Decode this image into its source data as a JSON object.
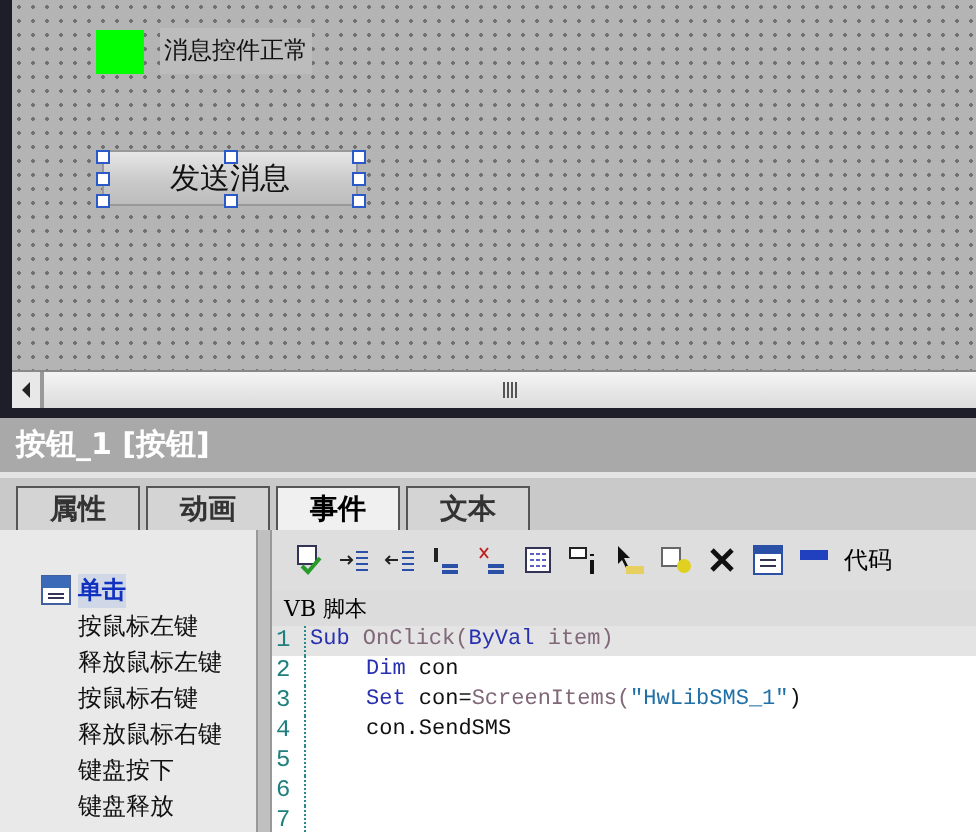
{
  "canvas": {
    "status": {
      "label": "消息控件正常",
      "color": "#00ff00"
    },
    "button": {
      "label": "发送消息",
      "selected": true
    }
  },
  "inspector": {
    "title": "按钮_1 [按钮]",
    "tabs": [
      {
        "label": "属性",
        "selected": false
      },
      {
        "label": "动画",
        "selected": false
      },
      {
        "label": "事件",
        "selected": true
      },
      {
        "label": "文本",
        "selected": false
      }
    ],
    "events": [
      {
        "label": "单击",
        "selected": true
      },
      {
        "label": "按鼠标左键",
        "selected": false
      },
      {
        "label": "释放鼠标左键",
        "selected": false
      },
      {
        "label": "按鼠标右键",
        "selected": false
      },
      {
        "label": "释放鼠标右键",
        "selected": false
      },
      {
        "label": "键盘按下",
        "selected": false
      },
      {
        "label": "键盘释放",
        "selected": false
      }
    ],
    "toolbar_text": "代码",
    "script_header": "VB 脚本",
    "code": [
      {
        "number": "1",
        "selected": true,
        "tokens": [
          {
            "kind": "keyword",
            "text": "Sub"
          },
          {
            "kind": "name",
            "text": " OnClick("
          },
          {
            "kind": "keyword",
            "text": "ByVal"
          },
          {
            "kind": "name",
            "text": " item)"
          }
        ]
      },
      {
        "number": "2",
        "selected": false,
        "indent": true,
        "tokens": [
          {
            "kind": "keyword",
            "text": "Dim"
          },
          {
            "kind": "text",
            "text": " con"
          }
        ]
      },
      {
        "number": "3",
        "selected": false,
        "indent": true,
        "tokens": [
          {
            "kind": "keyword",
            "text": "Set"
          },
          {
            "kind": "text",
            "text": " con="
          },
          {
            "kind": "name",
            "text": "ScreenItems("
          },
          {
            "kind": "string",
            "text": "\"HwLibSMS_1\""
          },
          {
            "kind": "text",
            "text": ")"
          }
        ]
      },
      {
        "number": "4",
        "selected": false,
        "indent": true,
        "tokens": [
          {
            "kind": "text",
            "text": "con.SendSMS"
          }
        ]
      },
      {
        "number": "5",
        "selected": false
      },
      {
        "number": "6",
        "selected": false
      },
      {
        "number": "7",
        "selected": false
      }
    ]
  }
}
